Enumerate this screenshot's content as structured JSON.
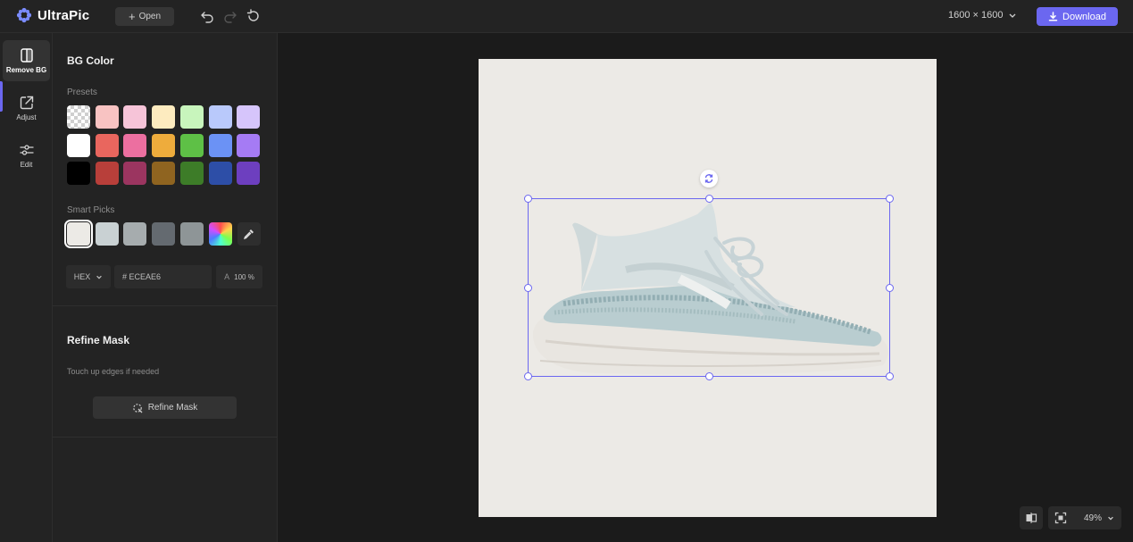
{
  "app": {
    "name": "UltraPic"
  },
  "toolbar": {
    "open_label": "Open",
    "canvas_size": "1600 × 1600",
    "download_label": "Download",
    "accent": "#6b67f0"
  },
  "rail": {
    "items": [
      {
        "label": "Remove BG",
        "icon": "remove-bg-icon",
        "active": true
      },
      {
        "label": "Adjust",
        "icon": "adjust-icon"
      },
      {
        "label": "Edit",
        "icon": "sliders-icon"
      }
    ]
  },
  "bg_color": {
    "title": "BG Color",
    "presets_label": "Presets",
    "presets": [
      [
        "transparent",
        "#f8c3c2",
        "#f6c4d8",
        "#fdebbf",
        "#c8f5bc",
        "#b9c9fb",
        "#d6c5fb"
      ],
      [
        "#ffffff",
        "#e9665e",
        "#ec6fa0",
        "#eeac3c",
        "#5ec046",
        "#6b92f5",
        "#a57bf4"
      ],
      [
        "#000000",
        "#b83f3a",
        "#9b3560",
        "#8f6420",
        "#3d7c28",
        "#2d4ea7",
        "#6d3fbf"
      ]
    ],
    "smart_picks_label": "Smart Picks",
    "smart_picks": [
      "#eceae6",
      "#c9d1d3",
      "#a6acae",
      "#646a70",
      "#8e9597",
      "rainbow"
    ],
    "format": "HEX",
    "hex_value": "# ECEAE6",
    "alpha_label": "A",
    "alpha_value": "100 %"
  },
  "refine": {
    "title": "Refine Mask",
    "hint": "Touch up edges if needed",
    "button_label": "Refine Mask"
  },
  "canvas": {
    "background": "#eceae6",
    "zoom": "49%"
  }
}
